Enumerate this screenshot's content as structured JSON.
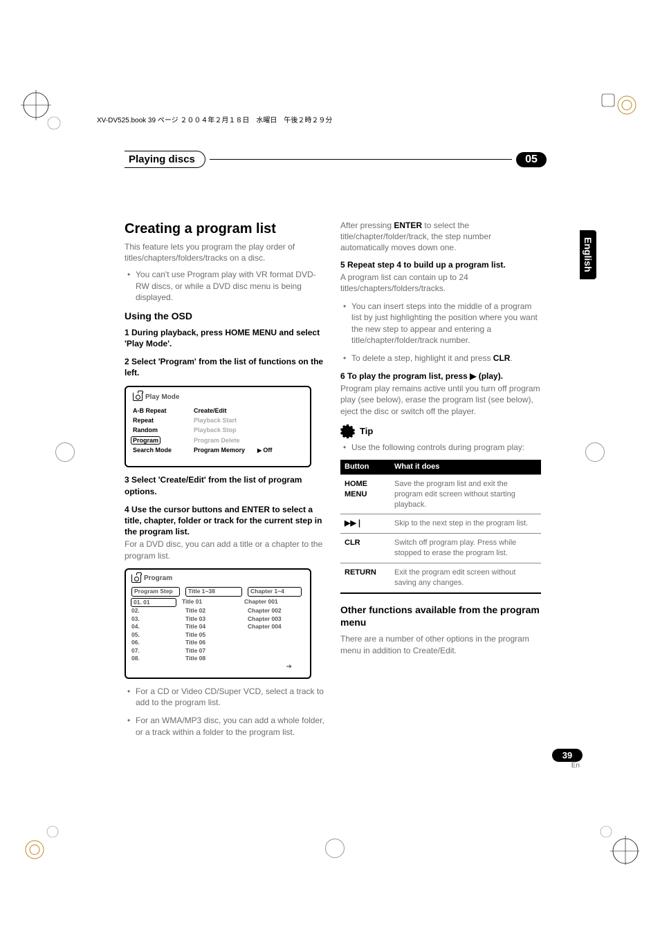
{
  "book_line": "XV-DV525.book  39 ページ  ２００４年２月１８日　水曜日　午後２時２９分",
  "header": {
    "title": "Playing discs",
    "chapter": "05"
  },
  "side_tab": "English",
  "left": {
    "h2": "Creating a program list",
    "intro": "This feature lets you program the play order of titles/chapters/folders/tracks on a disc.",
    "bullet1": "You can't use Program play with VR format DVD-RW discs, or while a DVD disc menu is being displayed.",
    "sub_osd": "Using the OSD",
    "step1": "1    During playback, press HOME MENU and select 'Play Mode'.",
    "step2": "2    Select 'Program' from the list of functions on the left.",
    "osd": {
      "title": "Play Mode",
      "rows": [
        {
          "l": "A-B Repeat",
          "r": "Create/Edit",
          "active": true
        },
        {
          "l": "Repeat",
          "r": "Playback Start"
        },
        {
          "l": "Random",
          "r": "Playback Stop"
        },
        {
          "l": "Program",
          "r": "Program Delete",
          "hl": true
        },
        {
          "l": "Search Mode",
          "r": "Program Memory",
          "extra": "Off",
          "active": true
        }
      ]
    },
    "step3": "3    Select 'Create/Edit' from the list of program options.",
    "step4": "4    Use the cursor buttons and ENTER to select a title, chapter, folder or track for the current step in the program list.",
    "step4_body": "For a DVD disc, you can add a title or a chapter to the program list.",
    "program": {
      "title": "Program",
      "headers": [
        "Program Step",
        "Title 1~38",
        "Chapter 1~4"
      ],
      "rows": [
        [
          "01. 01",
          "Title 01",
          "Chapter 001"
        ],
        [
          "02.",
          "Title 02",
          "Chapter 002"
        ],
        [
          "03.",
          "Title 03",
          "Chapter 003"
        ],
        [
          "04.",
          "Title 04",
          "Chapter 004"
        ],
        [
          "05.",
          "Title 05",
          ""
        ],
        [
          "06.",
          "Title 06",
          ""
        ],
        [
          "07.",
          "Title 07",
          ""
        ],
        [
          "08.",
          "Title 08",
          ""
        ]
      ]
    },
    "bullet2": "For a CD or Video CD/Super VCD, select a track to add to the program list.",
    "bullet3": "For an WMA/MP3 disc, you can add a whole folder, or a track within a folder to the program list."
  },
  "right": {
    "after_enter": "After pressing ENTER to select the title/chapter/folder/track, the step number automatically moves down one.",
    "step5": "5    Repeat step 4 to build up a program list.",
    "step5_body": "A program list can contain up to 24 titles/chapters/folders/tracks.",
    "bullet1": "You can insert steps into the middle of a program list by just highlighting the position where you want the new step to appear and entering a title/chapter/folder/track number.",
    "bullet2_pre": "To delete a step, highlight it and press ",
    "bullet2_btn": "CLR",
    "bullet2_post": ".",
    "step6": "6    To play the program list, press ▶ (play).",
    "step6_body": "Program play remains active until you turn off program play (see below), erase the program list (see below), eject the disc or switch off the player.",
    "tip_label": "Tip",
    "tip_bullet": "Use the following controls during program play:",
    "table": {
      "head": [
        "Button",
        "What it does"
      ],
      "rows": [
        {
          "b": "HOME MENU",
          "d": "Save the program list and exit the program edit screen without starting playback."
        },
        {
          "b": "▶▶|",
          "d": "Skip to the next step in the program list."
        },
        {
          "b": "CLR",
          "d": "Switch off program play. Press while stopped to erase the program list."
        },
        {
          "b": "RETURN",
          "d": "Exit the program edit screen without saving any changes."
        }
      ]
    },
    "sub": "Other functions available from the program menu",
    "sub_body": "There are a number of other options in the program menu in addition to Create/Edit."
  },
  "page": {
    "num": "39",
    "lang": "En"
  }
}
